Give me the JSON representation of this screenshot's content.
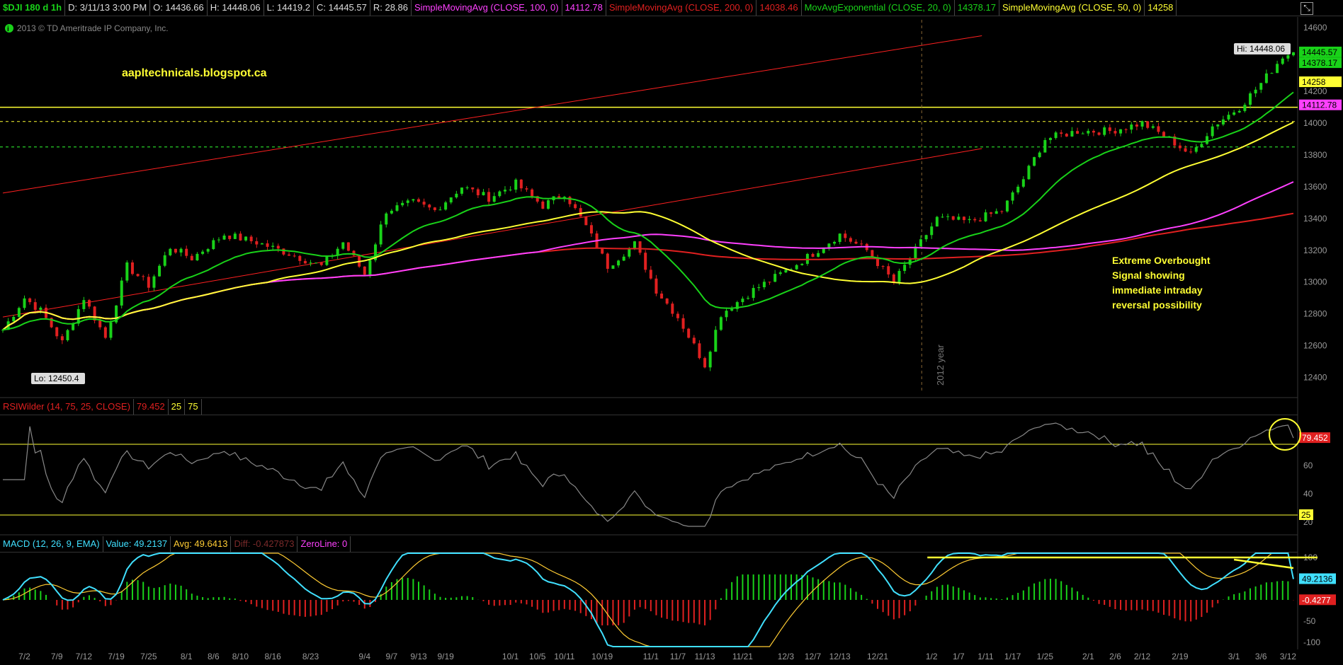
{
  "header": {
    "symbol": "$DJI 180 d 1h",
    "date": "D: 3/11/13 3:00 PM",
    "open": "O: 14436.66",
    "high": "H: 14448.06",
    "low": "L: 14419.2",
    "close": "C: 14445.57",
    "range": "R: 28.86",
    "sma100_label": "SimpleMovingAvg (CLOSE, 100, 0)",
    "sma100_value": "14112.78",
    "sma200_label": "SimpleMovingAvg (CLOSE, 200, 0)",
    "sma200_value": "14038.46",
    "ema20_label": "MovAvgExponential (CLOSE, 20, 0)",
    "ema20_value": "14378.17",
    "sma50_label": "SimpleMovingAvg (CLOSE, 50, 0)",
    "sma50_value": "14258"
  },
  "copyright": "2013 © TD Ameritrade IP Company, Inc.",
  "watermark": "aapltechnicals.blogspot.ca",
  "annotation": [
    "Extreme Overbought",
    "Signal showing",
    "immediate intraday",
    "reversal possibility"
  ],
  "year_label": "2012 year",
  "colors": {
    "bg": "#000000",
    "candle_up": "#19d219",
    "candle_down": "#e02020",
    "ema20": "#19d219",
    "sma50": "#ffff33",
    "sma100": "#ff40ff",
    "sma200": "#e02020",
    "trend": "#ff2020",
    "hline": "#ffff33",
    "hdash": "#33ff33",
    "rsi": "#888888",
    "macd": "#40e0ff",
    "macd_avg": "#ffcc33"
  },
  "chart_data": [
    {
      "type": "candlestick",
      "title": "",
      "ylim": [
        12300,
        14650
      ],
      "y_ticks": [
        "14600",
        "14400",
        "14200",
        "14000",
        "13800",
        "13600",
        "13400",
        "13200",
        "13000",
        "12800",
        "12600",
        "12400"
      ],
      "hi_label": "Hi: 14448.06",
      "lo_label": "Lo: 12450.4",
      "right_labels": [
        {
          "text": "14445.57",
          "value": 14445.57,
          "color": "#19d219"
        },
        {
          "text": "14378.17",
          "value": 14378.17,
          "color": "#19d219"
        },
        {
          "text": "14258",
          "value": 14258,
          "color": "#ffff33"
        },
        {
          "text": "14112.78",
          "value": 14112.78,
          "color": "#ff40ff"
        }
      ],
      "horizontal_lines": [
        {
          "value": 14100,
          "style": "solid",
          "color": "#ffff33"
        },
        {
          "value": 14010,
          "style": "dashed",
          "color": "#ffff33"
        },
        {
          "value": 13850,
          "style": "dashed",
          "color": "#33ff33"
        }
      ],
      "trendlines": [
        {
          "from": [
            0,
            13560
          ],
          "to": [
            180,
            14550
          ]
        },
        {
          "from": [
            0,
            12780
          ],
          "to": [
            180,
            13840
          ]
        }
      ],
      "x_tick_labels": [
        "7/2",
        "7/9",
        "7/12",
        "7/19",
        "7/25",
        "8/1",
        "8/6",
        "8/10",
        "8/16",
        "8/23",
        "9/4",
        "9/7",
        "9/13",
        "9/19",
        "10/1",
        "10/5",
        "10/11",
        "10/19",
        "11/1",
        "11/7",
        "11/13",
        "11/21",
        "12/3",
        "12/7",
        "12/13",
        "12/21",
        "1/2",
        "1/7",
        "1/11",
        "1/17",
        "1/25",
        "2/1",
        "2/6",
        "2/12",
        "2/19",
        "3/1",
        "3/6",
        "3/12"
      ],
      "x_tick_index": [
        4,
        10,
        15,
        21,
        27,
        34,
        39,
        44,
        50,
        57,
        67,
        72,
        77,
        82,
        94,
        99,
        104,
        111,
        120,
        125,
        130,
        137,
        145,
        150,
        155,
        162,
        172,
        177,
        182,
        187,
        193,
        201,
        206,
        211,
        218,
        228,
        233,
        238
      ],
      "x_count": 240,
      "close_anchors": [
        [
          0,
          12700
        ],
        [
          4,
          12900
        ],
        [
          7,
          12820
        ],
        [
          11,
          12620
        ],
        [
          15,
          12900
        ],
        [
          19,
          12650
        ],
        [
          23,
          13100
        ],
        [
          27,
          12980
        ],
        [
          31,
          13220
        ],
        [
          35,
          13150
        ],
        [
          41,
          13300
        ],
        [
          47,
          13250
        ],
        [
          53,
          13180
        ],
        [
          59,
          13100
        ],
        [
          63,
          13250
        ],
        [
          67,
          13050
        ],
        [
          71,
          13450
        ],
        [
          76,
          13500
        ],
        [
          80,
          13450
        ],
        [
          85,
          13600
        ],
        [
          90,
          13530
        ],
        [
          95,
          13620
        ],
        [
          100,
          13480
        ],
        [
          104,
          13560
        ],
        [
          108,
          13350
        ],
        [
          112,
          13100
        ],
        [
          117,
          13240
        ],
        [
          121,
          12950
        ],
        [
          125,
          12780
        ],
        [
          130,
          12480
        ],
        [
          133,
          12800
        ],
        [
          139,
          12950
        ],
        [
          145,
          13070
        ],
        [
          150,
          13180
        ],
        [
          155,
          13300
        ],
        [
          160,
          13200
        ],
        [
          165,
          13000
        ],
        [
          169,
          13200
        ],
        [
          173,
          13400
        ],
        [
          179,
          13380
        ],
        [
          185,
          13450
        ],
        [
          189,
          13650
        ],
        [
          193,
          13900
        ],
        [
          199,
          13950
        ],
        [
          205,
          13950
        ],
        [
          211,
          14000
        ],
        [
          216,
          13900
        ],
        [
          220,
          13800
        ],
        [
          224,
          13980
        ],
        [
          229,
          14100
        ],
        [
          233,
          14250
        ],
        [
          237,
          14420
        ],
        [
          239,
          14445
        ]
      ]
    },
    {
      "type": "line",
      "title": "RSIWilder (14, 75, 25, CLOSE)",
      "legend_value": "79.452",
      "legend_extra": [
        "25",
        "75"
      ],
      "ylim": [
        15,
        95
      ],
      "y_ticks": [
        "60",
        "40",
        "20"
      ],
      "levels": [
        {
          "value": 75,
          "label": "75"
        },
        {
          "value": 25,
          "label": "25"
        }
      ],
      "last_label": "79.452",
      "last_value": 79.452
    },
    {
      "type": "line",
      "title": "MACD (12, 26, 9, EMA)",
      "value_label": "Value: 49.2137",
      "avg_label": "Avg: 49.6413",
      "diff_label": "Diff: -0.427873",
      "zero_label": "ZeroLine: 0",
      "ylim": [
        -110,
        110
      ],
      "y_ticks": [
        "100",
        "50",
        "-50",
        "-100"
      ],
      "value_badge": "49.2136",
      "diff_badge": "-0.4277"
    }
  ]
}
